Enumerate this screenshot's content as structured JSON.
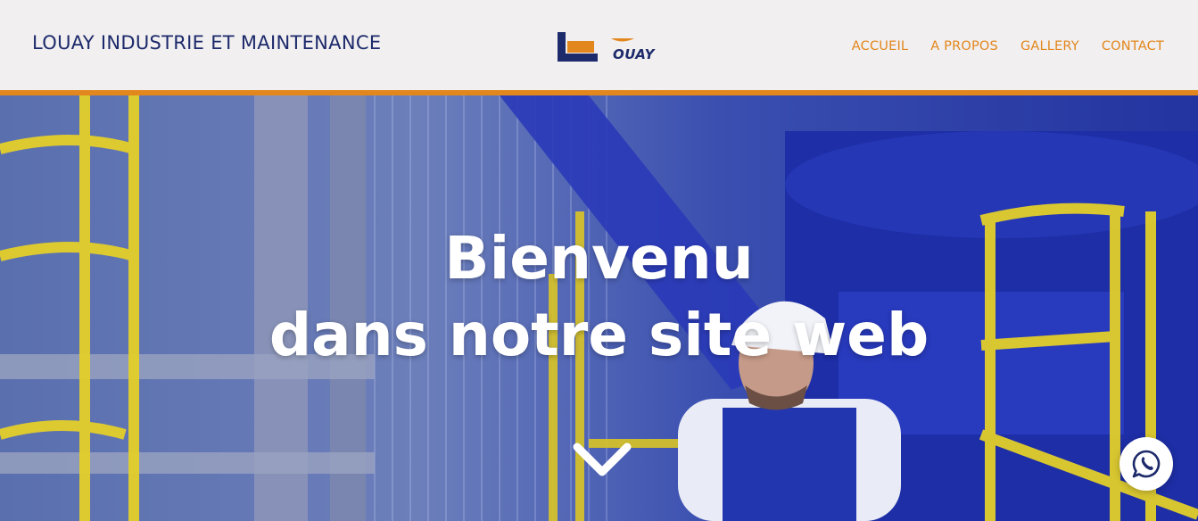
{
  "header": {
    "brand": "LOUAY INDUSTRIE ET MAINTENANCE",
    "logo_text": "OUAY"
  },
  "nav": {
    "items": [
      {
        "label": "ACCUEIL"
      },
      {
        "label": "A PROPOS"
      },
      {
        "label": "GALLERY"
      },
      {
        "label": "CONTACT"
      }
    ]
  },
  "hero": {
    "title_line1": "Bienvenu",
    "title_line2": "dans notre site web",
    "scroll_icon": "chevron-down-icon"
  },
  "floating": {
    "icon": "whatsapp-icon"
  },
  "colors": {
    "accent": "#e2871d",
    "brand": "#1d2a6b",
    "header_bg": "#f1eff0",
    "hero_overlay": "#2b3d9e"
  }
}
